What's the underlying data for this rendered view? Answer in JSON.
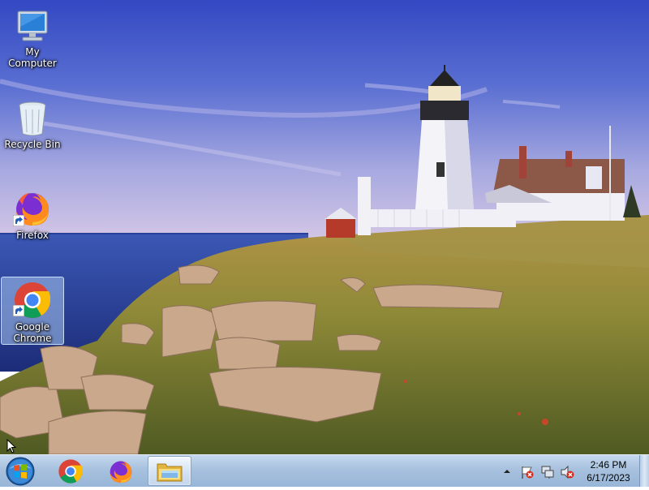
{
  "desktop": {
    "icons": [
      {
        "label": "My Computer",
        "icon": "my-computer-icon"
      },
      {
        "label": "Recycle Bin",
        "icon": "recycle-bin-icon"
      },
      {
        "label": "Firefox",
        "icon": "firefox-icon",
        "shortcut": true
      },
      {
        "label": "Google Chrome",
        "icon": "google-chrome-icon",
        "shortcut": true,
        "selected": true
      }
    ],
    "wallpaper": "lighthouse-coast"
  },
  "taskbar": {
    "start_icon": "windows-start-orb",
    "pinned": [
      {
        "name": "Google Chrome",
        "icon": "chrome-icon"
      },
      {
        "name": "Firefox",
        "icon": "firefox-icon"
      },
      {
        "name": "Windows Explorer",
        "icon": "folder-icon",
        "active": true
      }
    ],
    "tray": {
      "icons": [
        "show-hidden-icons-arrow",
        "action-center-flag-icon",
        "network-icon",
        "volume-muted-icon"
      ],
      "time": "2:46 PM",
      "date": "6/17/2023"
    }
  },
  "colors": {
    "taskbar": "#a7c1de",
    "selection": "#aac8f0"
  }
}
